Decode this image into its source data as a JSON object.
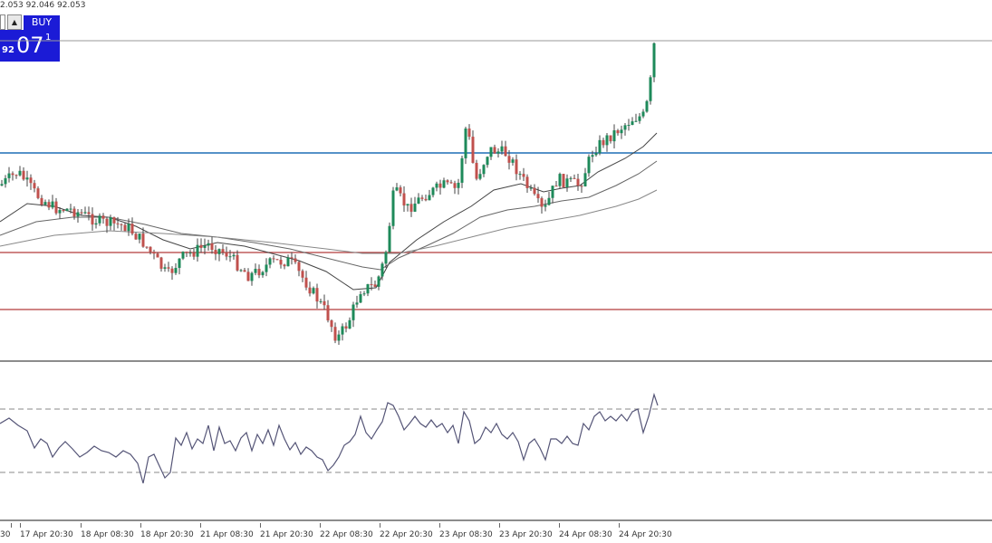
{
  "header": {
    "ohlc_text": "2.053 92.046 92.053"
  },
  "trade_panel": {
    "qty_value": "0",
    "up_arrow": "▲",
    "buy_label": "BUY",
    "price_small": "92",
    "price_big": "07",
    "price_sup": "1"
  },
  "colors": {
    "bull_candle": "#1e8a5a",
    "bear_candle": "#c0504d",
    "wick": "#444444",
    "blue_level": "#1f6fb5",
    "red_level": "#b23a3a",
    "ma_line": "#555555",
    "rsi_line": "#555577",
    "buy_button": "#1b1bd6"
  },
  "chart_data": {
    "type": "candlestick",
    "indicator": "RSI oscillator",
    "x_ticks": [
      "30",
      "17 Apr 20:30",
      "18 Apr 08:30",
      "18 Apr 20:30",
      "21 Apr 08:30",
      "21 Apr 20:30",
      "22 Apr 08:30",
      "22 Apr 20:30",
      "23 Apr 08:30",
      "23 Apr 20:30",
      "24 Apr 08:30",
      "24 Apr 20:30"
    ],
    "horizontal_levels": [
      "current-price",
      "blue-resistance",
      "red-support-upper",
      "red-support-lower"
    ],
    "moving_averages": 3,
    "rsi_levels": [
      "upper-dashed",
      "lower-dashed"
    ]
  }
}
